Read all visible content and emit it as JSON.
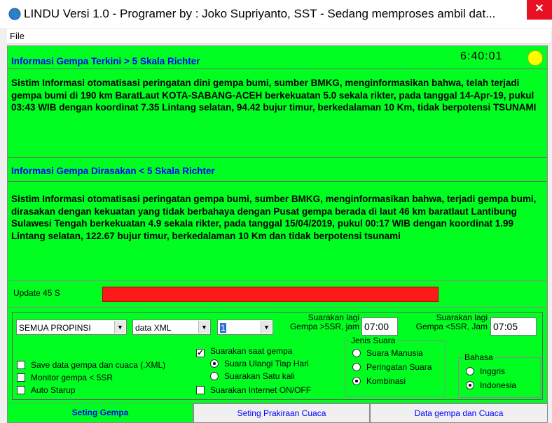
{
  "window": {
    "title": "LINDU Versi 1.0 - Programer by : Joko Supriyanto, SST - Sedang memproses ambil dat...",
    "close_glyph": "✕"
  },
  "menu": {
    "file": "File"
  },
  "alert_high": {
    "header": "Informasi Gempa Terkini > 5 Skala Richter",
    "clock": "6:40:01",
    "text": "Sistim Informasi otomatisasi peringatan dini gempa bumi, sumber BMKG, menginformasikan bahwa, telah terjadi gempa bumi di 190 km BaratLaut KOTA-SABANG-ACEH berkekuatan 5.0 sekala rikter,  pada tanggal 14-Apr-19, pukul 03:43 WIB  dengan koordinat 7.35 Lintang selatan, 94.42 bujur timur,  berkedalaman 10 Km, tidak berpotensi TSUNAMI"
  },
  "alert_felt": {
    "header": "Informasi Gempa Dirasakan < 5 Skala Richter",
    "text": "Sistim Informasi otomatisasi peringatan gempa bumi, sumber BMKG, menginformasikan bahwa, terjadi gempa bumi, dirasakan dengan kekuatan yang tidak berbahaya dengan Pusat gempa berada di laut 46 km baratlaut Lantibung Sulawesi Tengah berkekuatan 4.9 sekala rikter,  pada tanggal 15/04/2019, pukul 00:17 WIB  dengan koordinat 1.99 Lintang selatan, 122.67 bujur timur,  berkedalaman 10 Km dan tidak berpotensi tsunami"
  },
  "update": {
    "label": "Update 45 S",
    "progress_fraction": 1.0,
    "bar_color": "#ff1a1a"
  },
  "settings": {
    "province_select": "SEMUA PROPINSI",
    "data_select": "data XML",
    "number_select": "1",
    "repeat_gt5_label_1": "Suarakan lagi",
    "repeat_gt5_label_2": "Gempa >5SR, jam",
    "repeat_gt5_value": "07:00",
    "repeat_lt5_label_1": "Suarakan lagi",
    "repeat_lt5_label_2": "Gempa <5SR, Jam",
    "repeat_lt5_value": "07:05",
    "save_data": "Save data gempa dan cuaca (.XML)",
    "monitor": "Monitor gempa < 5SR",
    "auto_startup": "Auto Starup",
    "speak_on_quake": "Suarakan saat gempa",
    "repeat_daily": "Suara Ulangi Tiap Hari",
    "speak_once": "Suarakan Satu kali",
    "speak_internet": "Suarakan Internet ON/OFF",
    "voice_group": "Jenis Suara",
    "voice_human": "Suara Manusia",
    "voice_alarm": "Peringatan Suara",
    "voice_combo": "Kombinasi",
    "lang_group": "Bahasa",
    "lang_en": "Inggris",
    "lang_id": "Indonesia",
    "check_glyph": "✓",
    "arrow_glyph": "▼"
  },
  "tabs": [
    "Seting Gempa",
    "Seting Prakiraan Cuaca",
    "Data gempa dan Cuaca"
  ],
  "colors": {
    "panel_green": "#00ff21",
    "header_blue": "#0000ff",
    "sun": "#ffff00"
  }
}
